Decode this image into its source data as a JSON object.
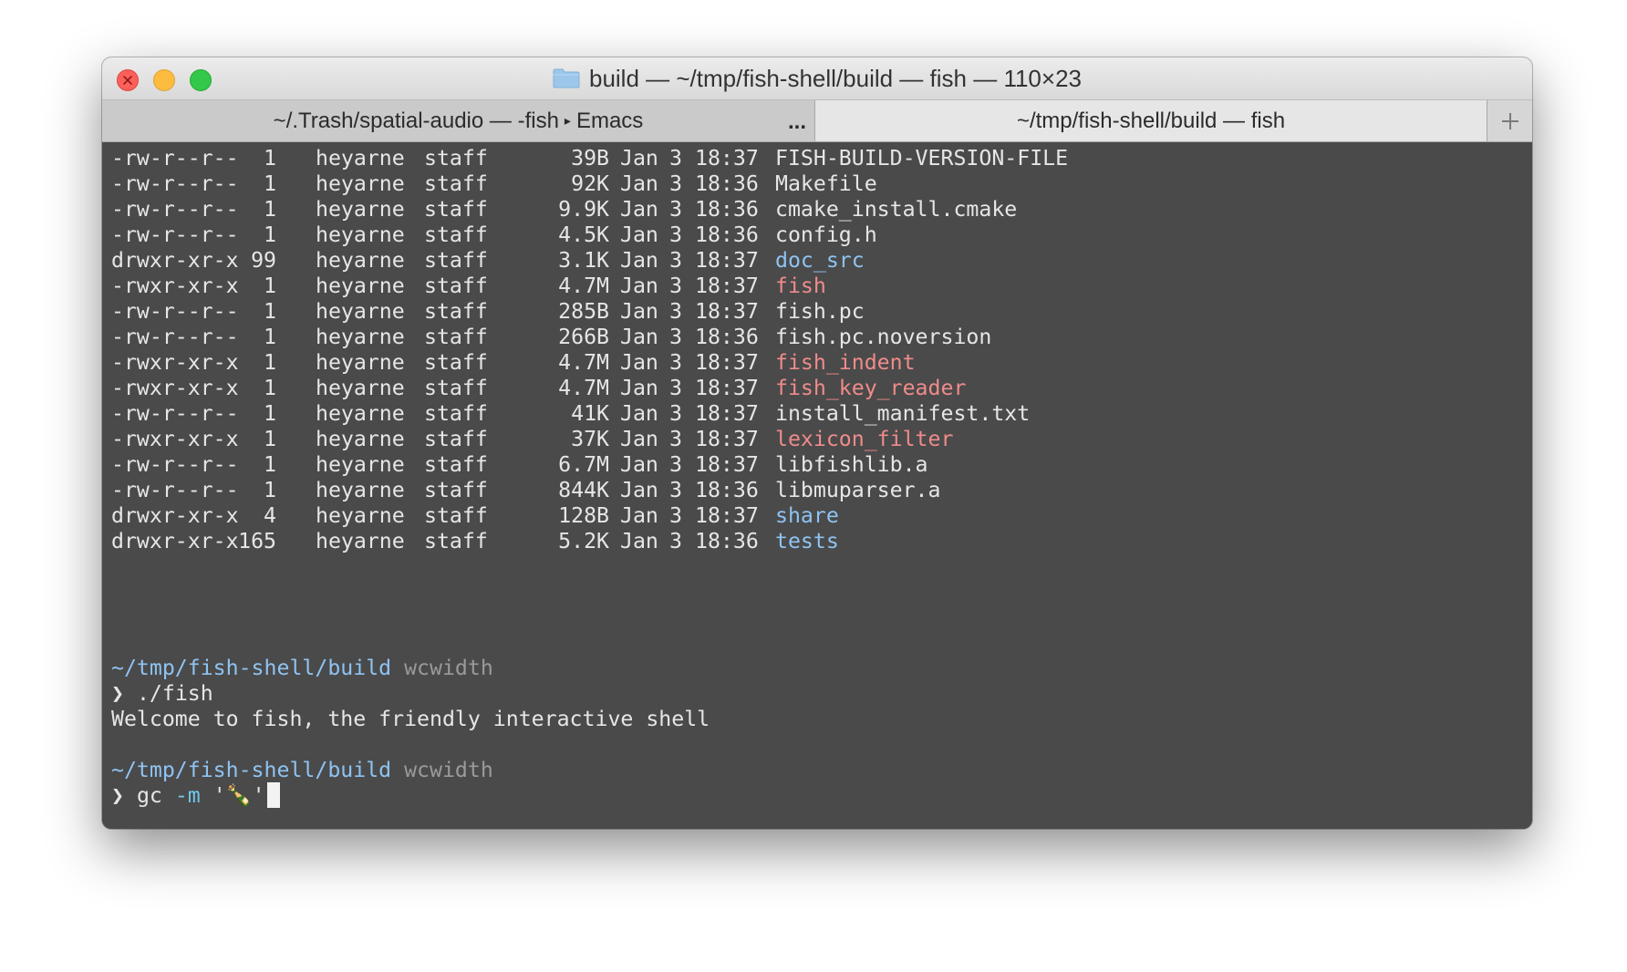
{
  "window": {
    "title": "build — ~/tmp/fish-shell/build — fish — 110×23"
  },
  "tabs": [
    {
      "label_a": "~/.Trash/spatial-audio — -fish",
      "label_b": "Emacs",
      "overflow": "..."
    },
    {
      "label": "~/tmp/fish-shell/build — fish"
    }
  ],
  "colors": {
    "terminal_bg": "#4a4a4a",
    "text": "#e6e6e6",
    "directory": "#8fc3f2",
    "executable": "#f08b8b"
  },
  "listing": [
    {
      "perm": "-rw-r--r--",
      "links": "1",
      "owner": "heyarne",
      "group": "staff",
      "size": "39B",
      "month": "Jan",
      "day": "3",
      "time": "18:37",
      "name": "FISH-BUILD-VERSION-FILE",
      "kind": "file"
    },
    {
      "perm": "-rw-r--r--",
      "links": "1",
      "owner": "heyarne",
      "group": "staff",
      "size": "92K",
      "month": "Jan",
      "day": "3",
      "time": "18:36",
      "name": "Makefile",
      "kind": "file"
    },
    {
      "perm": "-rw-r--r--",
      "links": "1",
      "owner": "heyarne",
      "group": "staff",
      "size": "9.9K",
      "month": "Jan",
      "day": "3",
      "time": "18:36",
      "name": "cmake_install.cmake",
      "kind": "file"
    },
    {
      "perm": "-rw-r--r--",
      "links": "1",
      "owner": "heyarne",
      "group": "staff",
      "size": "4.5K",
      "month": "Jan",
      "day": "3",
      "time": "18:36",
      "name": "config.h",
      "kind": "file"
    },
    {
      "perm": "drwxr-xr-x",
      "links": "99",
      "owner": "heyarne",
      "group": "staff",
      "size": "3.1K",
      "month": "Jan",
      "day": "3",
      "time": "18:37",
      "name": "doc_src",
      "kind": "dir"
    },
    {
      "perm": "-rwxr-xr-x",
      "links": "1",
      "owner": "heyarne",
      "group": "staff",
      "size": "4.7M",
      "month": "Jan",
      "day": "3",
      "time": "18:37",
      "name": "fish",
      "kind": "exec"
    },
    {
      "perm": "-rw-r--r--",
      "links": "1",
      "owner": "heyarne",
      "group": "staff",
      "size": "285B",
      "month": "Jan",
      "day": "3",
      "time": "18:37",
      "name": "fish.pc",
      "kind": "file"
    },
    {
      "perm": "-rw-r--r--",
      "links": "1",
      "owner": "heyarne",
      "group": "staff",
      "size": "266B",
      "month": "Jan",
      "day": "3",
      "time": "18:36",
      "name": "fish.pc.noversion",
      "kind": "file"
    },
    {
      "perm": "-rwxr-xr-x",
      "links": "1",
      "owner": "heyarne",
      "group": "staff",
      "size": "4.7M",
      "month": "Jan",
      "day": "3",
      "time": "18:37",
      "name": "fish_indent",
      "kind": "exec"
    },
    {
      "perm": "-rwxr-xr-x",
      "links": "1",
      "owner": "heyarne",
      "group": "staff",
      "size": "4.7M",
      "month": "Jan",
      "day": "3",
      "time": "18:37",
      "name": "fish_key_reader",
      "kind": "exec"
    },
    {
      "perm": "-rw-r--r--",
      "links": "1",
      "owner": "heyarne",
      "group": "staff",
      "size": "41K",
      "month": "Jan",
      "day": "3",
      "time": "18:37",
      "name": "install_manifest.txt",
      "kind": "file"
    },
    {
      "perm": "-rwxr-xr-x",
      "links": "1",
      "owner": "heyarne",
      "group": "staff",
      "size": "37K",
      "month": "Jan",
      "day": "3",
      "time": "18:37",
      "name": "lexicon_filter",
      "kind": "exec"
    },
    {
      "perm": "-rw-r--r--",
      "links": "1",
      "owner": "heyarne",
      "group": "staff",
      "size": "6.7M",
      "month": "Jan",
      "day": "3",
      "time": "18:37",
      "name": "libfishlib.a",
      "kind": "file"
    },
    {
      "perm": "-rw-r--r--",
      "links": "1",
      "owner": "heyarne",
      "group": "staff",
      "size": "844K",
      "month": "Jan",
      "day": "3",
      "time": "18:36",
      "name": "libmuparser.a",
      "kind": "file"
    },
    {
      "perm": "drwxr-xr-x",
      "links": "4",
      "owner": "heyarne",
      "group": "staff",
      "size": "128B",
      "month": "Jan",
      "day": "3",
      "time": "18:37",
      "name": "share",
      "kind": "dir"
    },
    {
      "perm": "drwxr-xr-x",
      "links": "165",
      "owner": "heyarne",
      "group": "staff",
      "size": "5.2K",
      "month": "Jan",
      "day": "3",
      "time": "18:36",
      "name": "tests",
      "kind": "dir"
    }
  ],
  "session": {
    "prompt1": {
      "path": "~/tmp/fish-shell/build",
      "branch": "wcwidth",
      "chevron": "❯",
      "command": "./fish"
    },
    "welcome": "Welcome to fish, the friendly interactive shell",
    "prompt2": {
      "path": "~/tmp/fish-shell/build",
      "branch": "wcwidth",
      "chevron": "❯",
      "cmd": "gc",
      "option": "-m",
      "quote_open": "'",
      "emoji": "🍾",
      "quote_close": "'"
    }
  }
}
